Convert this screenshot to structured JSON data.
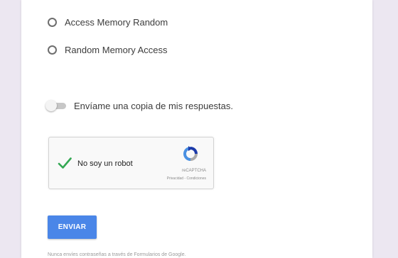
{
  "options": [
    {
      "label": "Access Memory Random",
      "selected": false
    },
    {
      "label": "Random Memory Access",
      "selected": false
    }
  ],
  "copy_toggle": {
    "label": "Envíame una copia de mis respuestas.",
    "on": false
  },
  "recaptcha": {
    "label": "No soy un robot",
    "checked": true,
    "brand": "reCAPTCHA",
    "terms": "Privacidad - Condiciones",
    "check_color": "#34a853",
    "logo_colors": [
      "#1c3aa9",
      "#4a90e2",
      "#abaaab"
    ]
  },
  "submit": {
    "label": "ENVIAR",
    "color": "#4a86e8"
  },
  "footnote": "Nunca envíes contraseñas a través de Formularios de Google."
}
